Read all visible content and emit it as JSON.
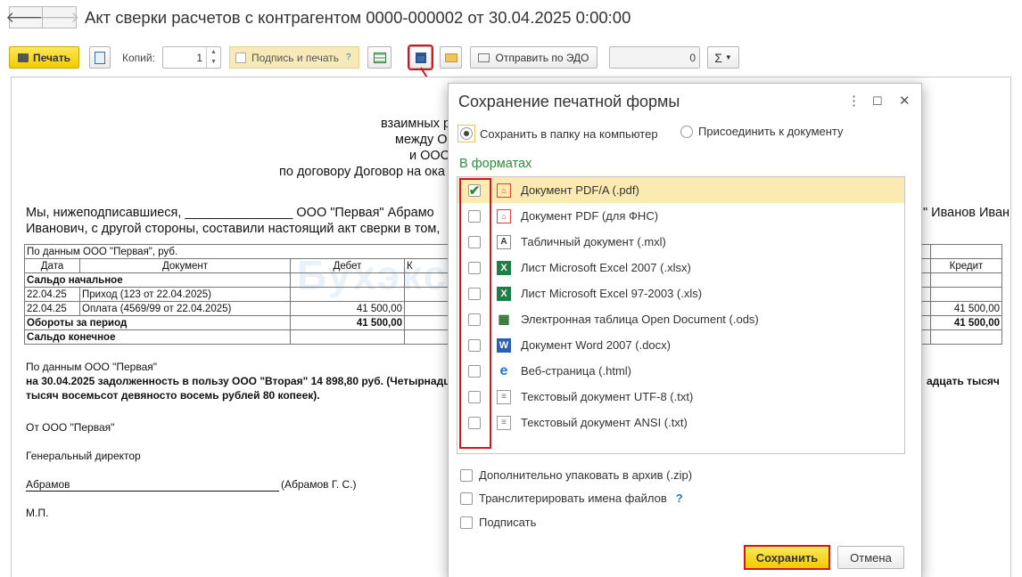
{
  "header": {
    "title": "Акт сверки расчетов с контрагентом 0000-000002 от 30.04.2025 0:00:00",
    "back": "🡐",
    "forward": "🡒"
  },
  "toolbar": {
    "print": "Печать",
    "copies_label": "Копий:",
    "copies_value": "1",
    "sign_print": "Подпись и печать",
    "help": "?",
    "edo": "Отправить по ЭДО",
    "counter": "0",
    "sigma": "Σ"
  },
  "doc": {
    "c1": "взаимных р",
    "c2": "между О",
    "c3": "и ООС",
    "c4": "по договору Договор на ока",
    "p1": "Мы, нижеподписавшиеся, _______________ ООО \"Первая\" Абрамо",
    "p1r": "\" Иванов Иван",
    "p2": "Иванович, с другой стороны, составили настоящий акт сверки в том,",
    "t_by": "По данным ООО \"Первая\", руб.",
    "h_date": "Дата",
    "h_doc": "Документ",
    "h_debit": "Дебет",
    "h_k": "К",
    "h_credit": "Кредит",
    "r_open": "Сальдо начальное",
    "r1_date": "22.04.25",
    "r1_doc": "Приход (123 от 22.04.2025)",
    "r2_date": "22.04.25",
    "r2_doc": "Оплата (4569/99 от 22.04.2025)",
    "r2_debit": "41 500,00",
    "r2_credit": "41 500,00",
    "r_turn": "Обороты за период",
    "r_turn_debit": "41 500,00",
    "r_turn_credit": "41 500,00",
    "r_close": "Сальдо конечное",
    "s1": "По данным ООО \"Первая\"",
    "s2": "на 30.04.2025 задолженность в пользу ООО \"Вторая\" 14 898,80 руб. (Четырнадц",
    "s2r": "адцать тысяч",
    "s3": "тысяч восемьсот девяносто восемь рублей 80 копеек).",
    "s4": "От ООО \"Первая\"",
    "s5": "Генеральный директор",
    "s6": "Абрамов",
    "s6b": "(Абрамов Г. С.)",
    "s7": "М.П.",
    "watermark": "Бухэксперт"
  },
  "dialog": {
    "title": "Сохранение печатной формы",
    "menu": "⋮",
    "maximize": "☐",
    "close": "✕",
    "radio1": "Сохранить в папку на компьютер",
    "radio2": "Присоединить к документу",
    "section": "В форматах",
    "formats": [
      {
        "label": "Документ PDF/A (.pdf)",
        "checked": true,
        "icon": "pdf-icon"
      },
      {
        "label": "Документ PDF (для ФНС)",
        "checked": false,
        "icon": "pdf-icon"
      },
      {
        "label": "Табличный документ (.mxl)",
        "checked": false,
        "icon": "mxl-icon"
      },
      {
        "label": "Лист Microsoft Excel 2007 (.xlsx)",
        "checked": false,
        "icon": "excel-icon"
      },
      {
        "label": "Лист Microsoft Excel 97-2003 (.xls)",
        "checked": false,
        "icon": "excel-icon"
      },
      {
        "label": "Электронная таблица Open Document (.ods)",
        "checked": false,
        "icon": "ods-icon"
      },
      {
        "label": "Документ Word 2007 (.docx)",
        "checked": false,
        "icon": "word-icon"
      },
      {
        "label": "Веб-страница (.html)",
        "checked": false,
        "icon": "html-icon"
      },
      {
        "label": "Текстовый документ UTF-8 (.txt)",
        "checked": false,
        "icon": "txt-icon"
      },
      {
        "label": "Текстовый документ ANSI (.txt)",
        "checked": false,
        "icon": "txt-icon"
      }
    ],
    "opt_zip": "Дополнительно упаковать в архив (.zip)",
    "opt_translit": "Транслитерировать имена файлов",
    "opt_help": "?",
    "opt_sign": "Подписать",
    "save": "Сохранить",
    "cancel": "Отмена"
  },
  "colors": {
    "accent_yellow": "#f2cb00",
    "highlight_red": "#d4161c",
    "section_green": "#2e8b3e",
    "selected_row": "#fbeab1"
  }
}
